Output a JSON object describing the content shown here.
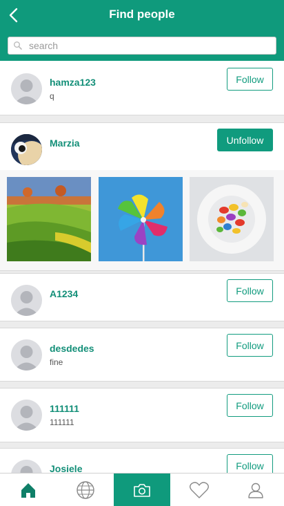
{
  "header": {
    "title": "Find people",
    "back_icon": "chevron-left-icon"
  },
  "search": {
    "placeholder": "search",
    "value": ""
  },
  "colors": {
    "accent": "#0f9a7c",
    "text_accent": "#138f78",
    "background": "#ececec"
  },
  "people": [
    {
      "username": "hamza123",
      "subtitle": "q",
      "action": "Follow"
    },
    {
      "username": "Marzia",
      "subtitle": "",
      "action": "Unfollow",
      "photos": [
        "hills-photo",
        "pinwheel-photo",
        "jellybeans-photo"
      ]
    },
    {
      "username": "A1234",
      "subtitle": "",
      "action": "Follow"
    },
    {
      "username": "desdedes",
      "subtitle": "fine",
      "action": "Follow"
    },
    {
      "username": "111111",
      "subtitle": "111111",
      "action": "Follow"
    },
    {
      "username": "Josiele",
      "subtitle": "",
      "action": "Follow"
    }
  ],
  "nav": {
    "items": [
      {
        "icon": "home-icon",
        "active": false
      },
      {
        "icon": "globe-icon",
        "active": false
      },
      {
        "icon": "camera-icon",
        "active": true
      },
      {
        "icon": "heart-icon",
        "active": false
      },
      {
        "icon": "profile-icon",
        "active": false
      }
    ]
  }
}
